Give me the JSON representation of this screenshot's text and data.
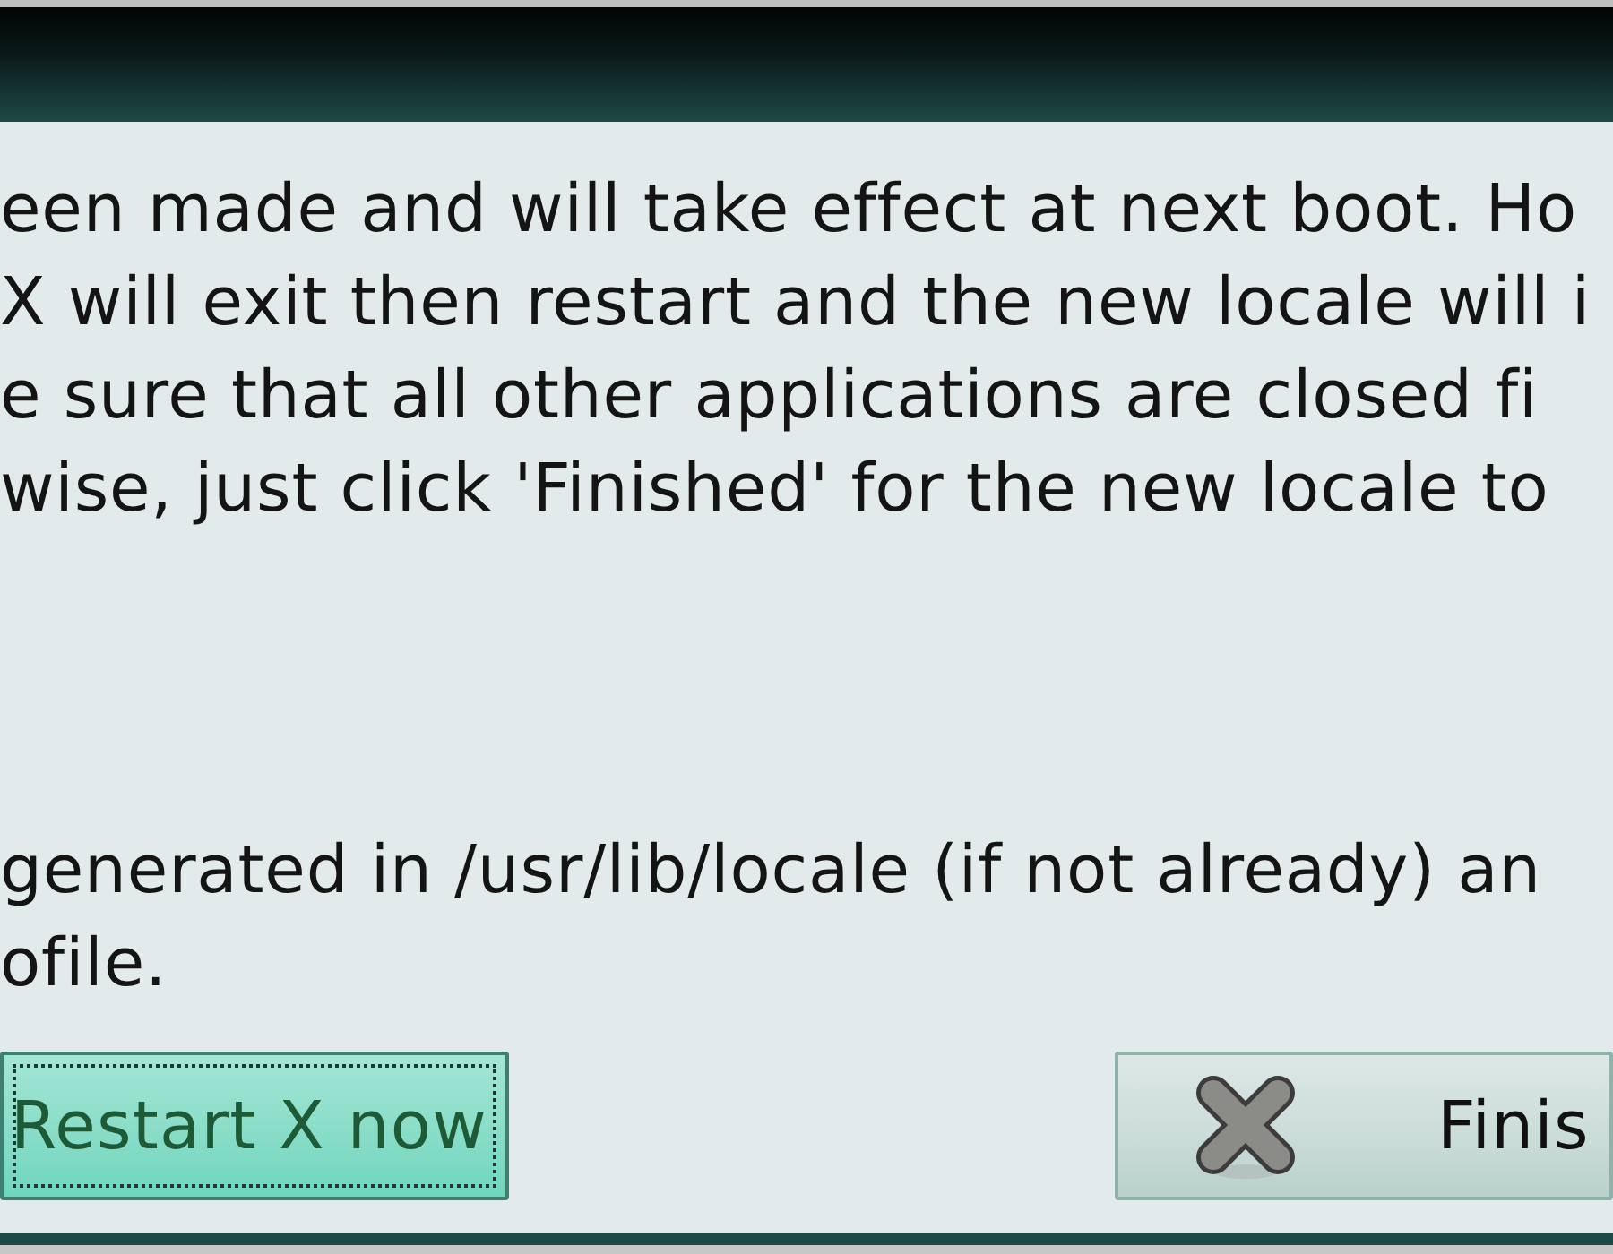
{
  "message": {
    "paragraphs": [
      {
        "lines": [
          "een made and will take effect at next boot. Ho",
          "X will exit then restart and the new locale will i",
          "e sure that all other applications are closed fi",
          "wise, just click 'Finished' for the new locale to"
        ]
      },
      {
        "lines": [
          "generated in /usr/lib/locale (if not already) an",
          "ofile."
        ]
      }
    ]
  },
  "buttons": [
    {
      "label": "Restart X now",
      "kind": "restart",
      "focused": true
    },
    {
      "label": "Finis",
      "kind": "finish",
      "focused": false
    }
  ]
}
